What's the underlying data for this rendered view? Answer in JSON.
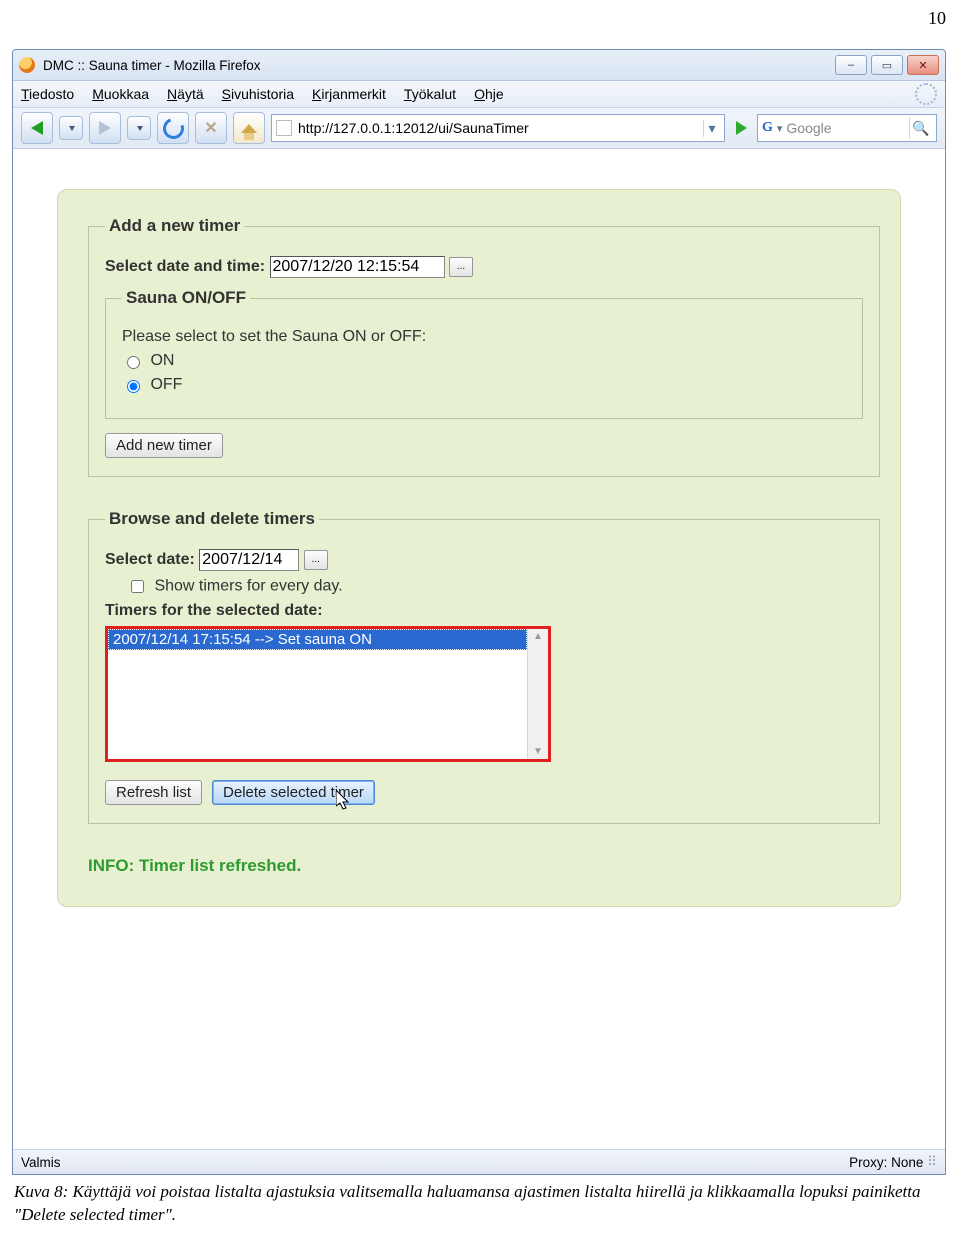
{
  "doc": {
    "page_number": "10"
  },
  "window": {
    "title": "DMC :: Sauna timer - Mozilla Firefox",
    "min_label": "–",
    "max_label": "▭",
    "close_label": "✕"
  },
  "menu": {
    "items": [
      "Tiedosto",
      "Muokkaa",
      "Näytä",
      "Sivuhistoria",
      "Kirjanmerkit",
      "Työkalut",
      "Ohje"
    ]
  },
  "toolbar": {
    "url": "http://127.0.0.1:12012/ui/SaunaTimer",
    "search_placeholder": "Google",
    "search_engine_prefix": "G"
  },
  "panel": {
    "add": {
      "legend": "Add a new timer",
      "select_dt_label": "Select date and time:",
      "datetime_value": "2007/12/20 12:15:54",
      "picker_btn": "...",
      "sauna_legend": "Sauna ON/OFF",
      "sauna_prompt": "Please select to set the Sauna ON or OFF:",
      "opt_on": "ON",
      "opt_off": "OFF",
      "add_btn": "Add new timer"
    },
    "browse": {
      "legend": "Browse and delete timers",
      "select_date_label": "Select date:",
      "date_value": "2007/12/14",
      "picker_btn": "...",
      "show_all_label": "Show timers for every day.",
      "timers_label": "Timers for the selected date:",
      "list_item": "2007/12/14 17:15:54 --> Set sauna ON",
      "refresh_btn": "Refresh list",
      "delete_btn": "Delete selected timer"
    },
    "info": "INFO: Timer list refreshed."
  },
  "status": {
    "left": "Valmis",
    "right": "Proxy: None"
  },
  "caption": "Kuva 8: Käyttäjä voi poistaa listalta ajastuksia valitsemalla haluamansa ajastimen listalta hiirellä ja klikkaamalla lopuksi painiketta \"Delete selected timer\"."
}
